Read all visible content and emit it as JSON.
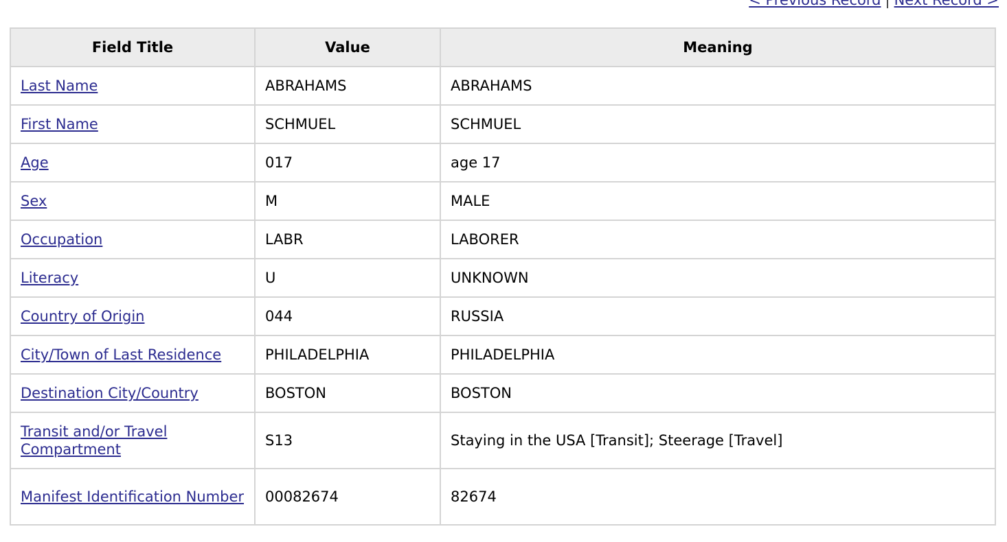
{
  "nav": {
    "previous_label": "< Previous Record",
    "separator": "|",
    "next_label": "Next Record >"
  },
  "table": {
    "headers": [
      "Field Title",
      "Value",
      "Meaning"
    ],
    "rows": [
      {
        "field": "Last Name",
        "value": "ABRAHAMS",
        "meaning": "ABRAHAMS"
      },
      {
        "field": "First Name",
        "value": "SCHMUEL",
        "meaning": "SCHMUEL"
      },
      {
        "field": "Age",
        "value": "017",
        "meaning": "age 17"
      },
      {
        "field": "Sex",
        "value": "M",
        "meaning": "MALE"
      },
      {
        "field": "Occupation",
        "value": "LABR",
        "meaning": "LABORER"
      },
      {
        "field": "Literacy",
        "value": "U",
        "meaning": "UNKNOWN"
      },
      {
        "field": "Country of Origin",
        "value": "044",
        "meaning": "RUSSIA"
      },
      {
        "field": "City/Town of Last Residence",
        "value": "PHILADELPHIA",
        "meaning": "PHILADELPHIA"
      },
      {
        "field": "Destination City/Country",
        "value": "BOSTON",
        "meaning": "BOSTON"
      },
      {
        "field": "Transit and/or Travel Compartment",
        "value": "S13",
        "meaning": "Staying in the USA [Transit]; Steerage [Travel]"
      },
      {
        "field": "Manifest Identification Number",
        "value": "00082674",
        "meaning": "82674"
      }
    ]
  }
}
